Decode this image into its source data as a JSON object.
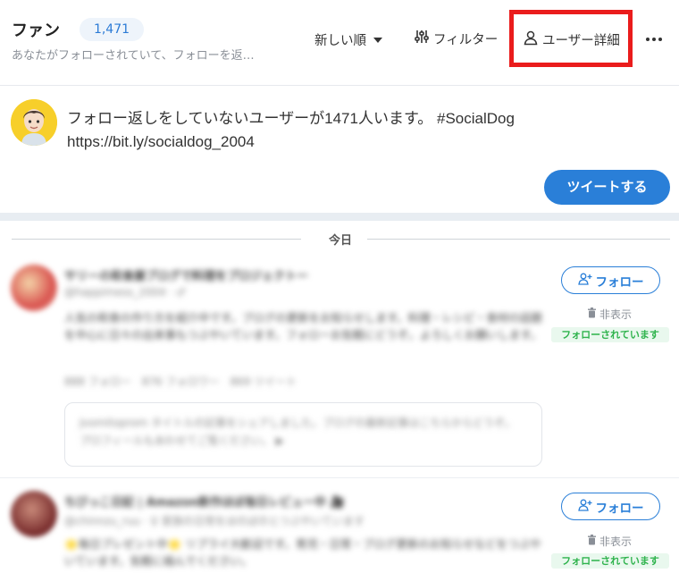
{
  "header": {
    "title": "ファン",
    "count": "1,471",
    "subtitle": "あなたがフォローされていて、フォローを返…",
    "sort_label": "新しい順",
    "filter_label": "フィルター",
    "user_detail_label": "ユーザー詳細"
  },
  "compose": {
    "line1": "フォロー返しをしていないユーザーが1471人います。 #SocialDog",
    "line2": "https://bit.ly/socialdog_2004",
    "tweet_button": "ツイートする"
  },
  "day_divider": "今日",
  "users": [
    {
      "name": "サリーの和食屋ブログで料理をプロジェクトー",
      "handle": "@happimess_2004 · ♂",
      "bio": "人気の和食の作り方を紹介中です。ブログの更新をお知らせします。料理・レシピ・食材の話題を中心に日々の出来事もつぶやいています。フォローお気軽にどうぞ。よろしくお願いします。",
      "stats": "888 フォロー　876 フォロワー　869 ツイート",
      "card": "Jvomitoprom タイトルの記事をシェアしました。ブログの最新記事はこちらからどうぞ。プロフィールもあわせてご覧ください。 ▶",
      "follow_label": "フォロー",
      "hide_label": "非表示",
      "follows_you": "フォローされています"
    },
    {
      "name": "ちびっこ日記 | Amazon新作ほぼ毎日レビュー中 🎥",
      "handle": "@chinnzu_ruu · ♀ 家族の日常をほのぼのとつぶやいています",
      "bio": "🌟毎日プレゼント中🌟 リプライ大歓迎です。育児・日常・ブログ更新のお知らせなどをつぶやいています。気軽に絡んでください。",
      "stats": "",
      "card": "",
      "follow_label": "フォロー",
      "hide_label": "非表示",
      "follows_you": "フォローされています"
    }
  ],
  "colors": {
    "accent": "#2a7fd8",
    "highlight_box": "#ea1c1c",
    "follows_you_text": "#2fb34d",
    "follows_you_bg": "#e9f8ee"
  }
}
